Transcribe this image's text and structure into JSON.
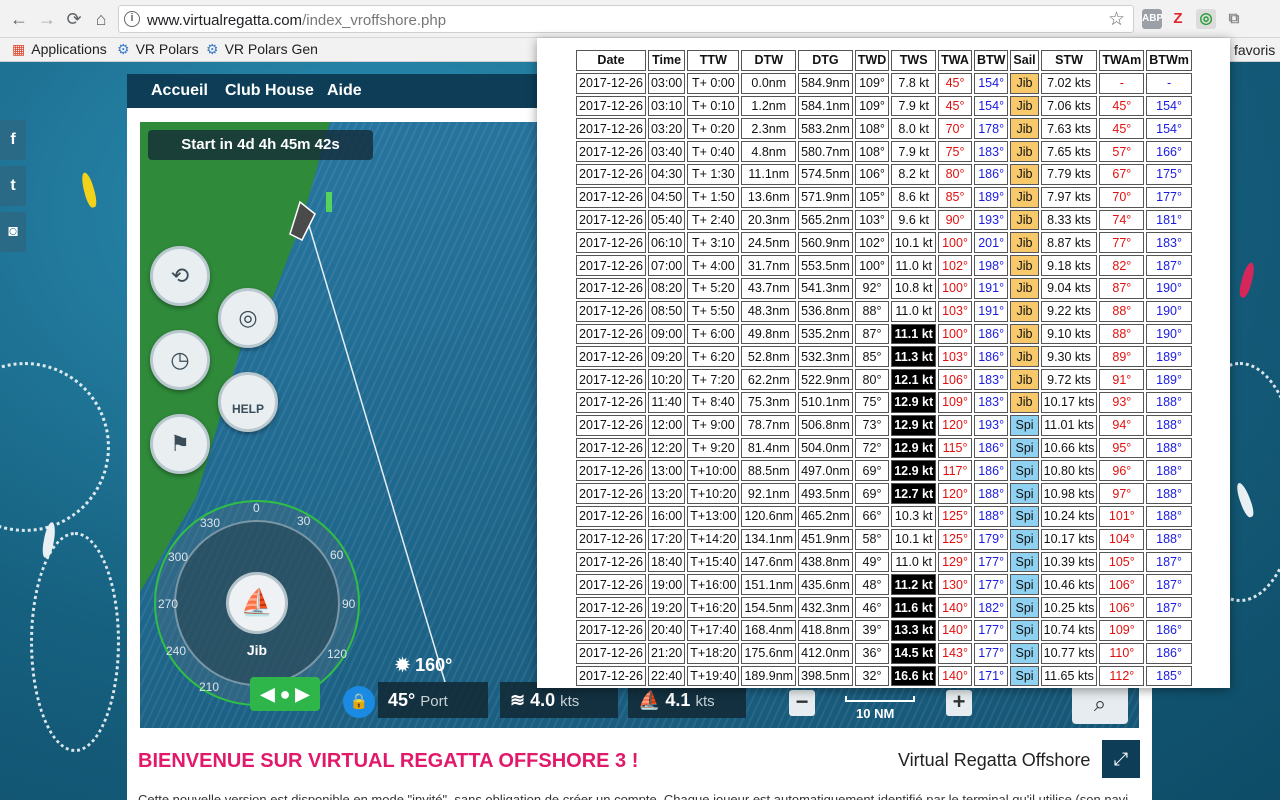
{
  "browser": {
    "url_domain": "www.virtualregatta.com",
    "url_path": "/index_vroffshore.php",
    "back": "←",
    "forward": "→",
    "reload": "⟳",
    "home": "⌂",
    "star": "☆",
    "extensions": [
      "ABP",
      "Z",
      "◎",
      "⧉"
    ],
    "bookmarks": [
      {
        "icon": "▦",
        "label": "Applications"
      },
      {
        "icon": "⚙",
        "label": "VR Polars"
      },
      {
        "icon": "⚙",
        "label": "VR Polars Gen"
      }
    ],
    "bookmarks_other": "favoris"
  },
  "site": {
    "nav": [
      "Accueil",
      "Club House",
      "Aide"
    ],
    "social": [
      "f",
      "t",
      "◙"
    ],
    "welcome_title": "BIENVENUE SUR VIRTUAL REGATTA OFFSHORE 3 !",
    "welcome_subtitle": "Virtual Regatta Offshore",
    "welcome_text": "Cette nouvelle version est disponible en mode \"invité\", sans obligation de créer un compte. Chaque joueur est automatiquement identifié par le terminal qu'il utilise (son navigateur s'il joue"
  },
  "game": {
    "start_timer": "Start in 4d 4h 45m 42s",
    "help_label": "HELP",
    "sail": "Jib",
    "compass_degrees": [
      "0",
      "30",
      "60",
      "90",
      "120",
      "210",
      "240",
      "270",
      "300",
      "330"
    ],
    "heading": "160°",
    "twa_value": "45°",
    "twa_side": "Port",
    "wind_speed": "4.0",
    "wind_unit": "kts",
    "boat_speed": "4.1",
    "boat_unit": "kts",
    "scale": "10 NM",
    "zoom_out": "−",
    "zoom_in": "+",
    "fullscreen": "⤢"
  },
  "routing_table": {
    "columns": [
      "Date",
      "Time",
      "TTW",
      "DTW",
      "DTG",
      "TWD",
      "TWS",
      "TWA",
      "BTW",
      "Sail",
      "STW",
      "TWAm",
      "BTWm"
    ],
    "rows": [
      [
        "2017-12-26",
        "03:00",
        "T+ 0:00",
        "0.0nm",
        "584.9nm",
        "109°",
        "7.8 kt",
        "45°",
        "154°",
        "Jib",
        "7.02 kts",
        "-",
        "-"
      ],
      [
        "2017-12-26",
        "03:10",
        "T+ 0:10",
        "1.2nm",
        "584.1nm",
        "109°",
        "7.9 kt",
        "45°",
        "154°",
        "Jib",
        "7.06 kts",
        "45°",
        "154°"
      ],
      [
        "2017-12-26",
        "03:20",
        "T+ 0:20",
        "2.3nm",
        "583.2nm",
        "108°",
        "8.0 kt",
        "70°",
        "178°",
        "Jib",
        "7.63 kts",
        "45°",
        "154°"
      ],
      [
        "2017-12-26",
        "03:40",
        "T+ 0:40",
        "4.8nm",
        "580.7nm",
        "108°",
        "7.9 kt",
        "75°",
        "183°",
        "Jib",
        "7.65 kts",
        "57°",
        "166°"
      ],
      [
        "2017-12-26",
        "04:30",
        "T+ 1:30",
        "11.1nm",
        "574.5nm",
        "106°",
        "8.2 kt",
        "80°",
        "186°",
        "Jib",
        "7.79 kts",
        "67°",
        "175°"
      ],
      [
        "2017-12-26",
        "04:50",
        "T+ 1:50",
        "13.6nm",
        "571.9nm",
        "105°",
        "8.6 kt",
        "85°",
        "189°",
        "Jib",
        "7.97 kts",
        "70°",
        "177°"
      ],
      [
        "2017-12-26",
        "05:40",
        "T+ 2:40",
        "20.3nm",
        "565.2nm",
        "103°",
        "9.6 kt",
        "90°",
        "193°",
        "Jib",
        "8.33 kts",
        "74°",
        "181°"
      ],
      [
        "2017-12-26",
        "06:10",
        "T+ 3:10",
        "24.5nm",
        "560.9nm",
        "102°",
        "10.1 kt",
        "100°",
        "201°",
        "Jib",
        "8.87 kts",
        "77°",
        "183°"
      ],
      [
        "2017-12-26",
        "07:00",
        "T+ 4:00",
        "31.7nm",
        "553.5nm",
        "100°",
        "11.0 kt",
        "102°",
        "198°",
        "Jib",
        "9.18 kts",
        "82°",
        "187°"
      ],
      [
        "2017-12-26",
        "08:20",
        "T+ 5:20",
        "43.7nm",
        "541.3nm",
        "92°",
        "10.8 kt",
        "100°",
        "191°",
        "Jib",
        "9.04 kts",
        "87°",
        "190°"
      ],
      [
        "2017-12-26",
        "08:50",
        "T+ 5:50",
        "48.3nm",
        "536.8nm",
        "88°",
        "11.0 kt",
        "103°",
        "191°",
        "Jib",
        "9.22 kts",
        "88°",
        "190°"
      ],
      [
        "2017-12-26",
        "09:00",
        "T+ 6:00",
        "49.8nm",
        "535.2nm",
        "87°",
        "11.1 kt",
        "100°",
        "186°",
        "Jib",
        "9.10 kts",
        "88°",
        "190°"
      ],
      [
        "2017-12-26",
        "09:20",
        "T+ 6:20",
        "52.8nm",
        "532.3nm",
        "85°",
        "11.3 kt",
        "103°",
        "186°",
        "Jib",
        "9.30 kts",
        "89°",
        "189°"
      ],
      [
        "2017-12-26",
        "10:20",
        "T+ 7:20",
        "62.2nm",
        "522.9nm",
        "80°",
        "12.1 kt",
        "106°",
        "183°",
        "Jib",
        "9.72 kts",
        "91°",
        "189°"
      ],
      [
        "2017-12-26",
        "11:40",
        "T+ 8:40",
        "75.3nm",
        "510.1nm",
        "75°",
        "12.9 kt",
        "109°",
        "183°",
        "Jib",
        "10.17 kts",
        "93°",
        "188°"
      ],
      [
        "2017-12-26",
        "12:00",
        "T+ 9:00",
        "78.7nm",
        "506.8nm",
        "73°",
        "12.9 kt",
        "120°",
        "193°",
        "Spi",
        "11.01 kts",
        "94°",
        "188°"
      ],
      [
        "2017-12-26",
        "12:20",
        "T+ 9:20",
        "81.4nm",
        "504.0nm",
        "72°",
        "12.9 kt",
        "115°",
        "186°",
        "Spi",
        "10.66 kts",
        "95°",
        "188°"
      ],
      [
        "2017-12-26",
        "13:00",
        "T+10:00",
        "88.5nm",
        "497.0nm",
        "69°",
        "12.9 kt",
        "117°",
        "186°",
        "Spi",
        "10.80 kts",
        "96°",
        "188°"
      ],
      [
        "2017-12-26",
        "13:20",
        "T+10:20",
        "92.1nm",
        "493.5nm",
        "69°",
        "12.7 kt",
        "120°",
        "188°",
        "Spi",
        "10.98 kts",
        "97°",
        "188°"
      ],
      [
        "2017-12-26",
        "16:00",
        "T+13:00",
        "120.6nm",
        "465.2nm",
        "66°",
        "10.3 kt",
        "125°",
        "188°",
        "Spi",
        "10.24 kts",
        "101°",
        "188°"
      ],
      [
        "2017-12-26",
        "17:20",
        "T+14:20",
        "134.1nm",
        "451.9nm",
        "58°",
        "10.1 kt",
        "125°",
        "179°",
        "Spi",
        "10.17 kts",
        "104°",
        "188°"
      ],
      [
        "2017-12-26",
        "18:40",
        "T+15:40",
        "147.6nm",
        "438.8nm",
        "49°",
        "11.0 kt",
        "129°",
        "177°",
        "Spi",
        "10.39 kts",
        "105°",
        "187°"
      ],
      [
        "2017-12-26",
        "19:00",
        "T+16:00",
        "151.1nm",
        "435.6nm",
        "48°",
        "11.2 kt",
        "130°",
        "177°",
        "Spi",
        "10.46 kts",
        "106°",
        "187°"
      ],
      [
        "2017-12-26",
        "19:20",
        "T+16:20",
        "154.5nm",
        "432.3nm",
        "46°",
        "11.6 kt",
        "140°",
        "182°",
        "Spi",
        "10.25 kts",
        "106°",
        "187°"
      ],
      [
        "2017-12-26",
        "20:40",
        "T+17:40",
        "168.4nm",
        "418.8nm",
        "39°",
        "13.3 kt",
        "140°",
        "177°",
        "Spi",
        "10.74 kts",
        "109°",
        "186°"
      ],
      [
        "2017-12-26",
        "21:20",
        "T+18:20",
        "175.6nm",
        "412.0nm",
        "36°",
        "14.5 kt",
        "143°",
        "177°",
        "Spi",
        "10.77 kts",
        "110°",
        "186°"
      ],
      [
        "2017-12-26",
        "22:40",
        "T+19:40",
        "189.9nm",
        "398.5nm",
        "32°",
        "16.6 kt",
        "140°",
        "171°",
        "Spi",
        "11.65 kts",
        "112°",
        "185°"
      ]
    ],
    "tws_highlight_rows": [
      11,
      12,
      13,
      14,
      15,
      16,
      17,
      18,
      22,
      23,
      24,
      25,
      26
    ],
    "colors": {
      "twa": "#e01010",
      "btw": "#1a1ae0",
      "jib": "#f7c96b",
      "spi": "#8fd1f1"
    }
  }
}
